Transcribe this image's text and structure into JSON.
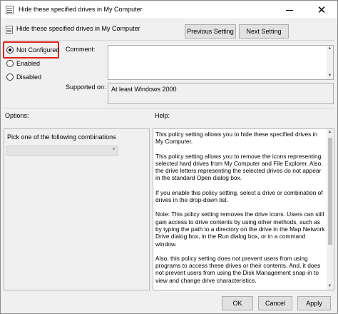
{
  "window": {
    "title": "Hide these specified drives in My Computer",
    "close_glyph": "✕"
  },
  "header": {
    "title": "Hide these specified drives in My Computer",
    "prev_label": "Previous Setting",
    "next_label": "Next Setting"
  },
  "state": {
    "options": [
      {
        "label": "Not Configured",
        "checked": true
      },
      {
        "label": "Enabled",
        "checked": false
      },
      {
        "label": "Disabled",
        "checked": false
      }
    ],
    "highlight_color": "#e0201b"
  },
  "comment": {
    "label": "Comment:",
    "value": ""
  },
  "supported": {
    "label": "Supported on:",
    "value": "At least Windows 2000"
  },
  "options_section": {
    "label": "Options:",
    "combo_label": "Pick one of the following combinations",
    "combo_value": ""
  },
  "help_section": {
    "label": "Help:",
    "paragraphs": [
      "This policy setting allows you to hide these specified drives in My Computer.",
      "This policy setting allows you to remove the icons representing selected hard drives from My Computer and File Explorer. Also, the drive letters representing the selected drives do not appear in the standard Open dialog box.",
      "If you enable this policy setting, select a drive or combination of drives in the drop-down list.",
      "Note: This policy setting removes the drive icons. Users can still gain access to drive contents by using other methods, such as by typing the path to a directory on the drive in the Map Network Drive dialog box, in the Run dialog box, or in a command window.",
      "Also, this policy setting does not prevent users from using programs to access these drives or their contents. And, it does not prevent users from using the Disk Management snap-in to view and change drive characteristics."
    ]
  },
  "footer": {
    "ok_label": "OK",
    "cancel_label": "Cancel",
    "apply_label": "Apply"
  }
}
